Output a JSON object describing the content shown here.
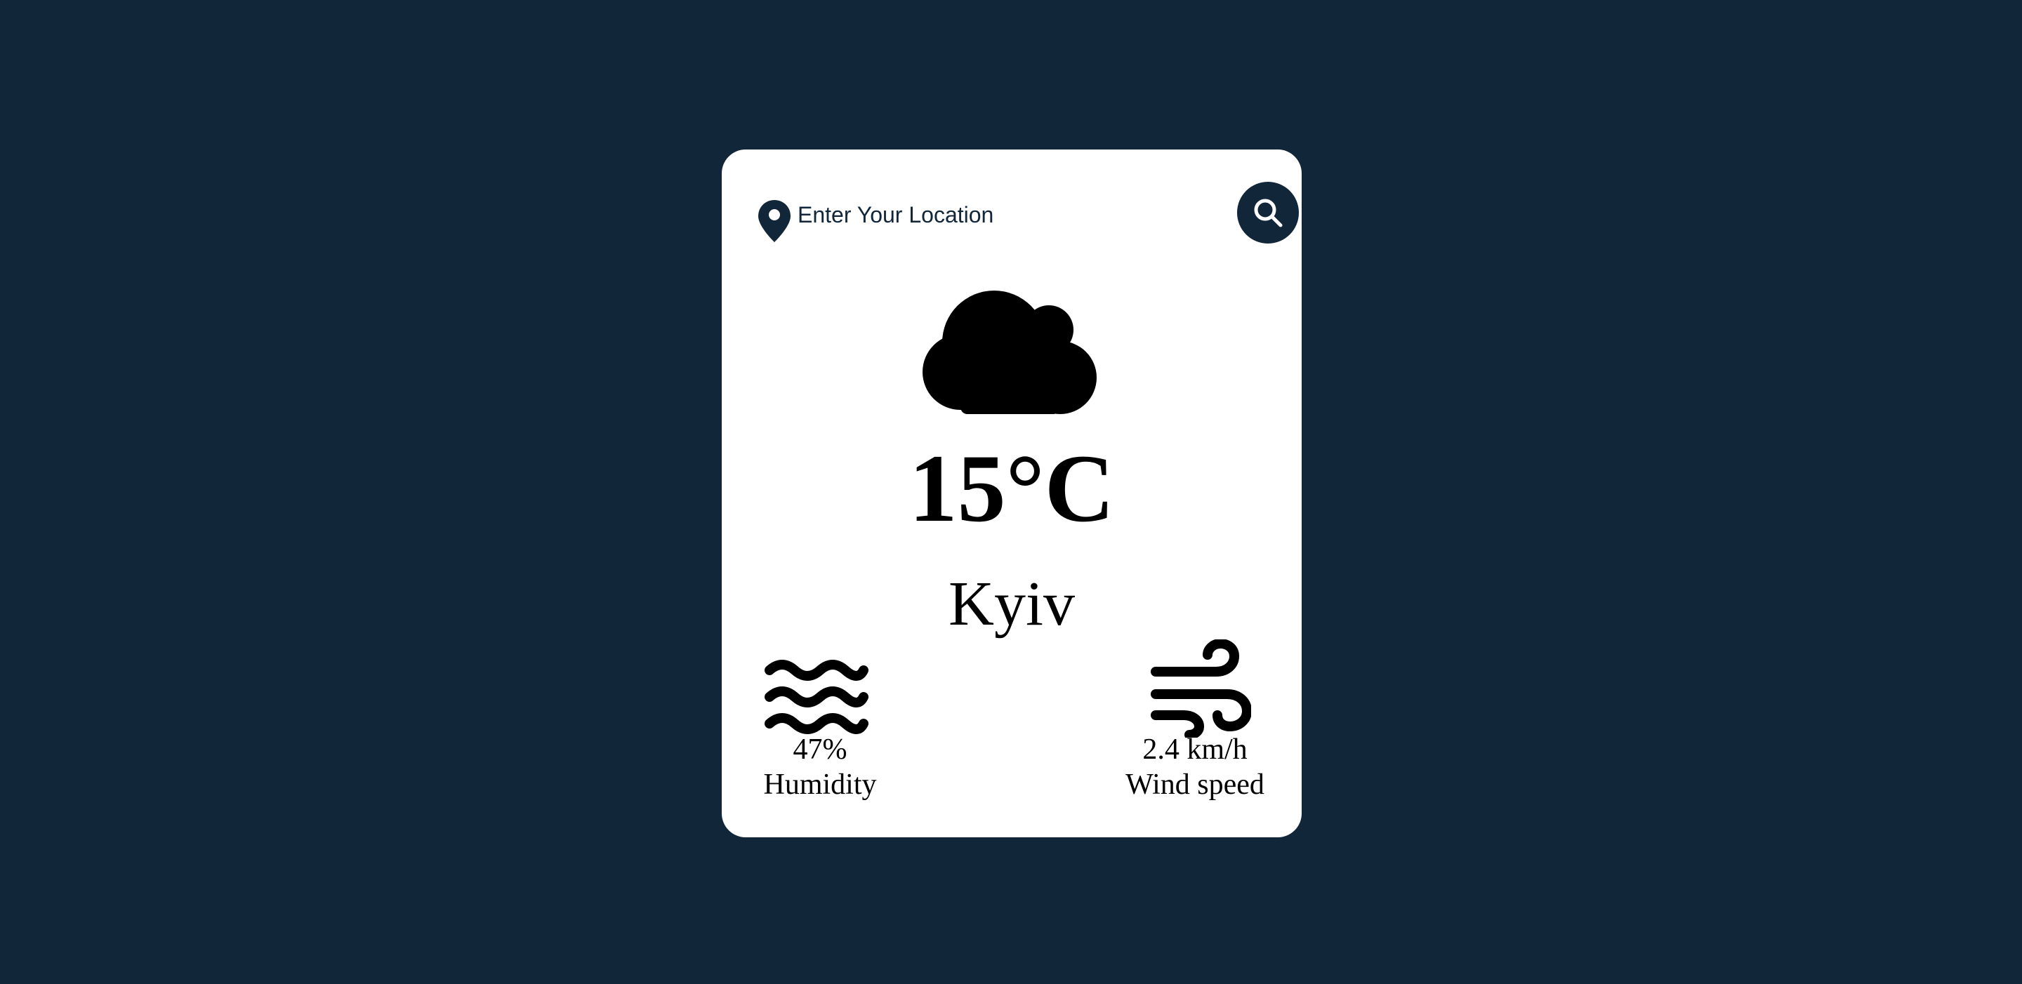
{
  "search": {
    "placeholder": "Enter Your Location"
  },
  "weather": {
    "condition_icon": "cloud-icon",
    "temperature": "15°C",
    "city": "Kyiv"
  },
  "details": {
    "humidity": {
      "icon": "water-waves-icon",
      "value": "47%",
      "label": "Humidity"
    },
    "wind": {
      "icon": "wind-icon",
      "value": "2.4 km/h",
      "label": "Wind speed"
    }
  },
  "colors": {
    "background": "#12263a",
    "card": "#ffffff",
    "accent": "#12263a",
    "text": "#000000"
  }
}
